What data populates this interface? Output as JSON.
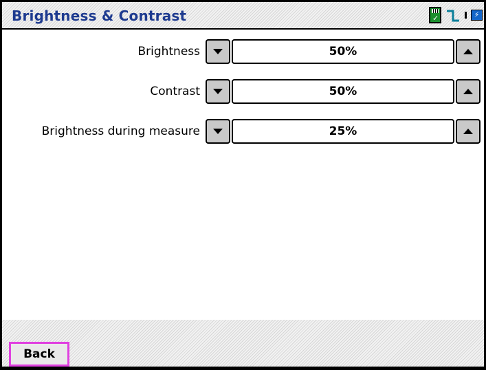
{
  "window": {
    "title": "Brightness & Contrast"
  },
  "status_icons": [
    "sd-card-ok-icon",
    "signal-icon",
    "battery-charging-icon"
  ],
  "settings": [
    {
      "label": "Brightness",
      "value": "50%"
    },
    {
      "label": "Contrast",
      "value": "50%"
    },
    {
      "label": "Brightness during measure",
      "value": "25%"
    }
  ],
  "footer": {
    "back_label": "Back"
  },
  "colors": {
    "title_text": "#1d3a8f",
    "button_gray": "#c9c9c9",
    "focus_border": "#e040e0",
    "sd_green": "#1c8f2e",
    "battery_blue": "#1566c9"
  }
}
